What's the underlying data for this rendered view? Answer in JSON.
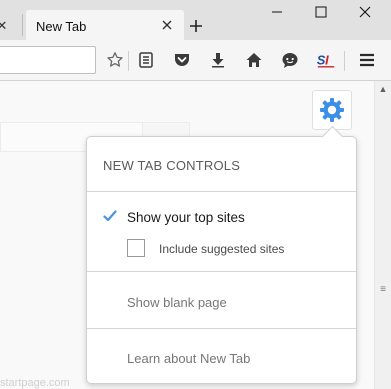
{
  "browser": {
    "tab": {
      "title": "New Tab"
    }
  },
  "content": {
    "footer_text": "startpage.com"
  },
  "popup": {
    "header": "NEW TAB CONTROLS",
    "options": {
      "top_sites": {
        "label": "Show your top sites",
        "checked": true
      },
      "suggested": {
        "label": "Include suggested sites",
        "checked": false
      },
      "blank": {
        "label": "Show blank page"
      },
      "learn": {
        "label": "Learn about New Tab"
      }
    }
  },
  "colors": {
    "accent": "#4a90e2",
    "gear": "#3d8ee6"
  },
  "icons": {
    "toolbar": [
      "bookmark-star-icon",
      "reading-list-icon",
      "pocket-icon",
      "download-icon",
      "home-icon",
      "chat-icon",
      "addon-si-icon",
      "menu-icon"
    ]
  }
}
